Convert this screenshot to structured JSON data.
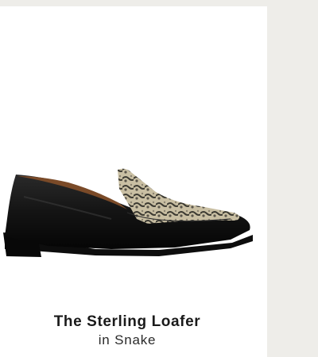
{
  "product": {
    "name": "The Sterling Loafer",
    "variant": "in Snake",
    "image": {
      "subject": "loafer-shoe",
      "colors": {
        "leather": "#111111",
        "lining": "#7a4a28",
        "snake_base": "#c9bfa3",
        "snake_dark": "#3c3a32"
      }
    }
  },
  "colors": {
    "page_background": "#eeede9",
    "card_background": "#ffffff",
    "text": "#1a1a1a"
  }
}
